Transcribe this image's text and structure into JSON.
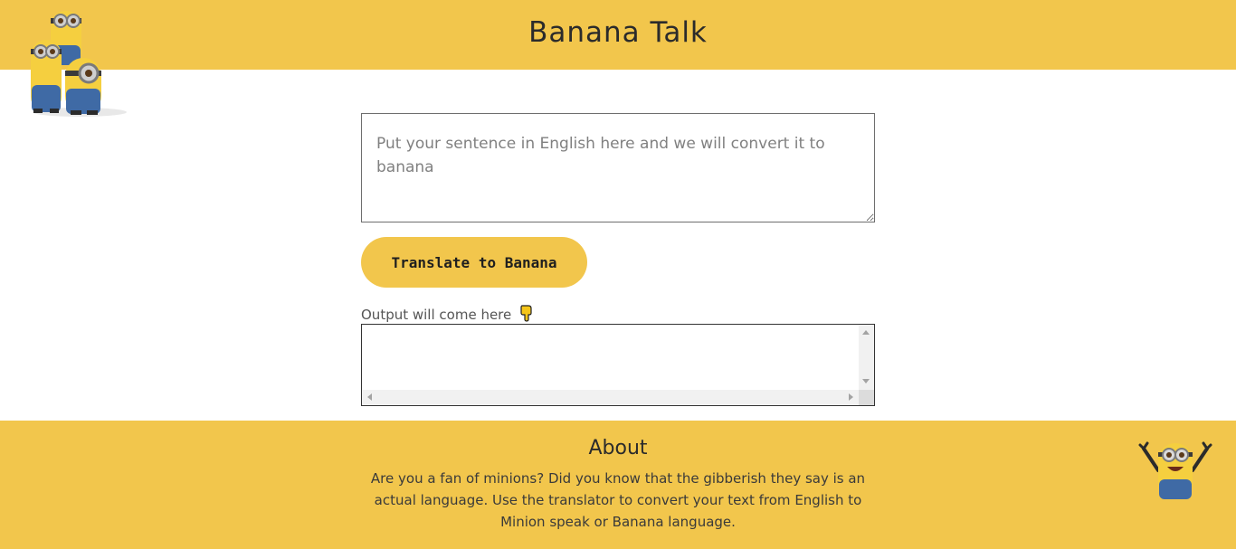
{
  "header": {
    "title": "Banana Talk",
    "background_color": "#f2c64c"
  },
  "main": {
    "input": {
      "value": "",
      "placeholder": "Put your sentence in English here and we will convert it to banana"
    },
    "translate_button_label": "Translate to Banana",
    "output_label": "Output will come here",
    "output_value": ""
  },
  "footer": {
    "heading": "About",
    "text": "Are you a fan of minions? Did you know that the gibberish they say is an actual language. Use the translator to convert your text from English to Minion speak or Banana language."
  },
  "icons": {
    "header_art": "minions-group-icon",
    "footer_art": "minion-waving-icon",
    "pointer": "pointing-down-hand-icon"
  },
  "colors": {
    "accent": "#f2c64c",
    "minion_yellow": "#f5cf3f",
    "overalls_blue": "#3f6aa5"
  }
}
